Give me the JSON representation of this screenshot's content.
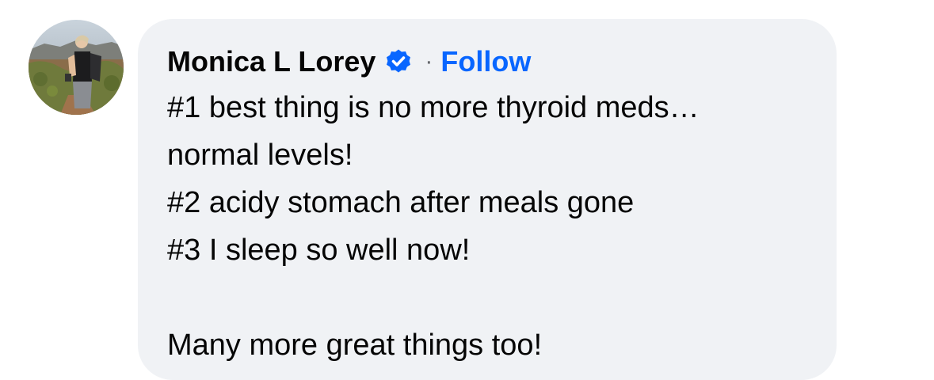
{
  "comment": {
    "author_name": "Monica L Lorey",
    "verified_icon": "verified-badge-icon",
    "separator": "·",
    "follow_label": "Follow",
    "lines": [
      "#1 best thing is no more thyroid meds…",
      "normal levels!",
      "#2 acidy stomach after meals gone",
      "#3 I sleep so well now!",
      "",
      "Many more great things too!"
    ]
  },
  "colors": {
    "bubble_bg": "#f0f2f5",
    "follow_blue": "#0866ff",
    "verified_blue": "#0866ff",
    "text": "#050505"
  }
}
